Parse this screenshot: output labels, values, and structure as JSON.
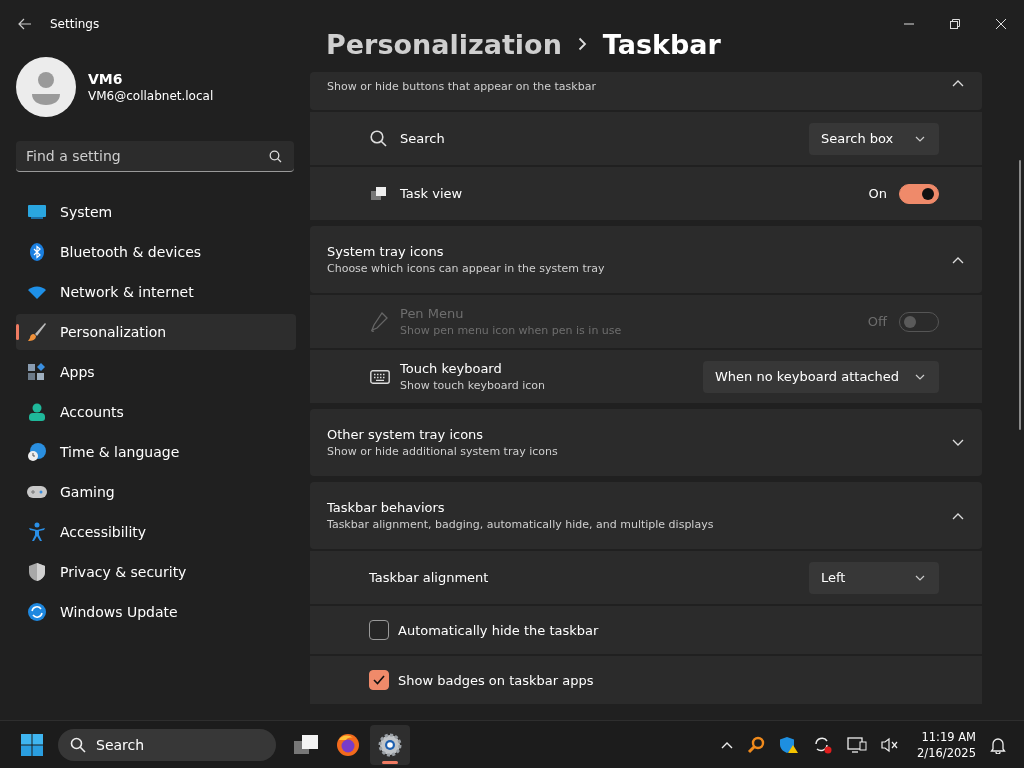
{
  "window": {
    "title": "Settings"
  },
  "user": {
    "name": "VM6",
    "email": "VM6@collabnet.local"
  },
  "search": {
    "placeholder": "Find a setting"
  },
  "nav": [
    {
      "label": "System",
      "selected": false
    },
    {
      "label": "Bluetooth & devices",
      "selected": false
    },
    {
      "label": "Network & internet",
      "selected": false
    },
    {
      "label": "Personalization",
      "selected": true
    },
    {
      "label": "Apps",
      "selected": false
    },
    {
      "label": "Accounts",
      "selected": false
    },
    {
      "label": "Time & language",
      "selected": false
    },
    {
      "label": "Gaming",
      "selected": false
    },
    {
      "label": "Accessibility",
      "selected": false
    },
    {
      "label": "Privacy & security",
      "selected": false
    },
    {
      "label": "Windows Update",
      "selected": false
    }
  ],
  "breadcrumb": {
    "parent": "Personalization",
    "current": "Taskbar"
  },
  "groups": [
    {
      "subtitle": "Show or hide buttons that appear on the taskbar",
      "expanded": true,
      "rows": [
        {
          "kind": "dropdown",
          "label": "Search",
          "value": "Search box",
          "disabled": false
        },
        {
          "kind": "toggle",
          "label": "Task view",
          "state": "On",
          "on": true,
          "disabled": false
        }
      ]
    },
    {
      "title": "System tray icons",
      "subtitle": "Choose which icons can appear in the system tray",
      "expanded": true,
      "rows": [
        {
          "kind": "toggle",
          "label": "Pen Menu",
          "description": "Show pen menu icon when pen is in use",
          "state": "Off",
          "on": false,
          "disabled": true
        },
        {
          "kind": "dropdown",
          "label": "Touch keyboard",
          "description": "Show touch keyboard icon",
          "value": "When no keyboard attached",
          "disabled": false
        }
      ]
    },
    {
      "title": "Other system tray icons",
      "subtitle": "Show or hide additional system tray icons",
      "expanded": false
    },
    {
      "title": "Taskbar behaviors",
      "subtitle": "Taskbar alignment, badging, automatically hide, and multiple displays",
      "expanded": true,
      "rows": [
        {
          "kind": "dropdown",
          "label": "Taskbar alignment",
          "value": "Left",
          "disabled": false
        },
        {
          "kind": "checkbox",
          "label": "Automatically hide the taskbar",
          "checked": false,
          "disabled": false
        },
        {
          "kind": "checkbox",
          "label": "Show badges on taskbar apps",
          "checked": true,
          "disabled": false
        }
      ]
    }
  ],
  "taskbar": {
    "search_placeholder": "Search",
    "apps": [
      {
        "selected": false
      },
      {
        "selected": false
      },
      {
        "selected": true
      }
    ],
    "time": "11:19 AM",
    "date": "2/16/2025"
  }
}
